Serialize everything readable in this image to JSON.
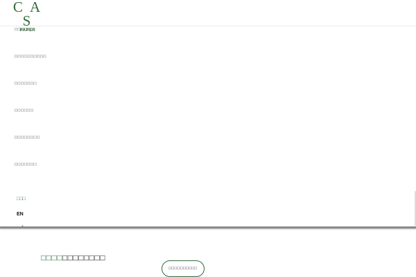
{
  "brand": {
    "logo_mark": "C A S",
    "logo_sub": "PAPER",
    "accent_color": "#2f6b3c"
  },
  "nav": {
    "items": [
      {
        "label": "□□□□□□"
      },
      {
        "label": "□□□□□□□□□□"
      },
      {
        "label": "□□□□□□□"
      },
      {
        "label": "□□□□□□"
      },
      {
        "label": "□□□□□□□□"
      },
      {
        "label": "□□□□□□□"
      }
    ]
  },
  "language": {
    "active_label": "□□□",
    "en_label": "EN"
  },
  "hero": {
    "headline_accent": "□□□□",
    "headline_rest": "□□□□□□□□",
    "cta_label": "□□□□□□□□□□"
  }
}
